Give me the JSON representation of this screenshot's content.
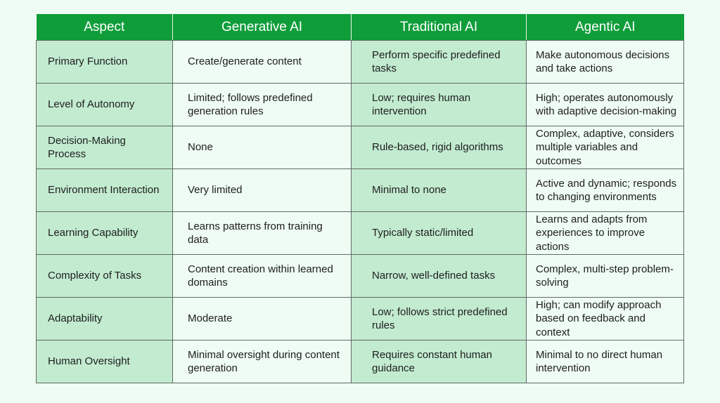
{
  "table": {
    "headers": [
      "Aspect",
      "Generative AI",
      "Traditional AI",
      "Agentic AI"
    ],
    "rows": [
      {
        "aspect": "Primary Function",
        "generative": "Create/generate content",
        "traditional": "Perform specific predefined tasks",
        "agentic": "Make autonomous decisions and take actions"
      },
      {
        "aspect": "Level of Autonomy",
        "generative": "Limited; follows predefined generation rules",
        "traditional": "Low; requires human intervention",
        "agentic": "High; operates autonomously with adaptive decision-making"
      },
      {
        "aspect": "Decision-Making Process",
        "generative": "None",
        "traditional": "Rule-based, rigid algorithms",
        "agentic": "Complex, adaptive, considers multiple variables and outcomes"
      },
      {
        "aspect": "Environment Interaction",
        "generative": "Very limited",
        "traditional": "Minimal to none",
        "agentic": "Active and dynamic; responds to changing environments"
      },
      {
        "aspect": "Learning Capability",
        "generative": "Learns patterns from training data",
        "traditional": "Typically static/limited",
        "agentic": "Learns and adapts from experiences to improve actions"
      },
      {
        "aspect": "Complexity of Tasks",
        "generative": "Content creation within learned domains",
        "traditional": "Narrow, well-defined tasks",
        "agentic": "Complex, multi-step problem-solving"
      },
      {
        "aspect": "Adaptability",
        "generative": "Moderate",
        "traditional": "Low; follows strict predefined rules",
        "agentic": "High; can modify approach based on feedback and context"
      },
      {
        "aspect": "Human Oversight",
        "generative": "Minimal oversight during content generation",
        "traditional": "Requires constant human guidance",
        "agentic": "Minimal to no direct human intervention"
      }
    ]
  },
  "colors": {
    "header_bg": "#0f9d3a",
    "header_text": "#ffffff",
    "shaded_cell": "#c2ebd0",
    "light_cell": "#eefcf3",
    "page_bg": "#effcf3"
  }
}
